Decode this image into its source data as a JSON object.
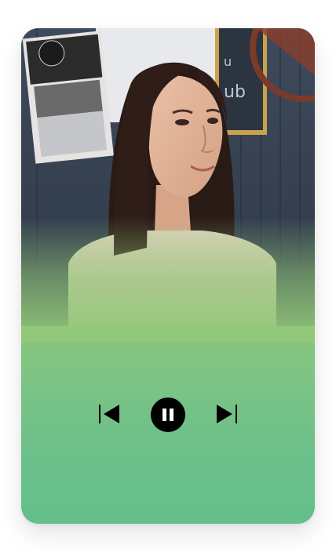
{
  "player": {
    "state": "playing",
    "accent_color": "#000000",
    "background_gradient": [
      "#93c87a",
      "#63bf8b"
    ],
    "controls": {
      "previous_icon": "skip-previous-icon",
      "playpause_icon": "pause-icon",
      "next_icon": "skip-next-icon"
    }
  },
  "photo": {
    "description_icon": "album-art-photo"
  }
}
